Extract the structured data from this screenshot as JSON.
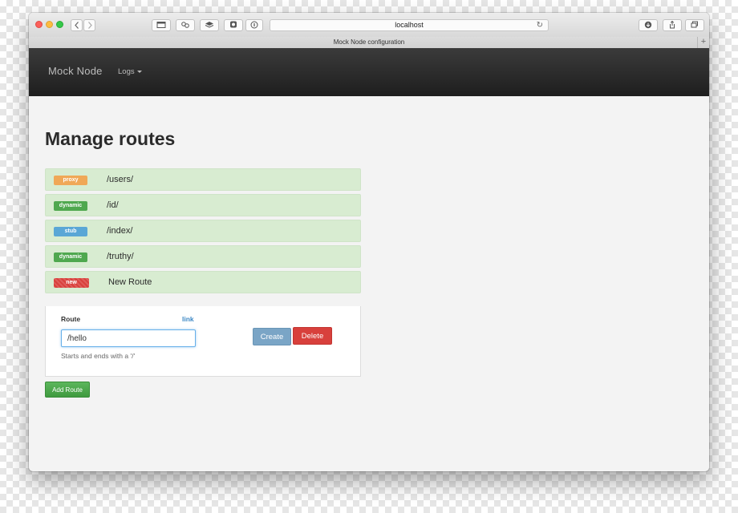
{
  "browser": {
    "url": "localhost",
    "tab_title": "Mock Node configuration",
    "new_tab_symbol": "+",
    "reload_symbol": "↻"
  },
  "navbar": {
    "brand": "Mock Node",
    "logs_label": "Logs"
  },
  "page": {
    "title": "Manage routes"
  },
  "routes": [
    {
      "type": "proxy",
      "path": "/users/",
      "badge_color": "#f0a857"
    },
    {
      "type": "dynamic",
      "path": "/id/",
      "badge_color": "#4fa84f"
    },
    {
      "type": "stub",
      "path": "/index/",
      "badge_color": "#5aa7d6"
    },
    {
      "type": "dynamic",
      "path": "/truthy/",
      "badge_color": "#4fa84f"
    },
    {
      "type": "new",
      "path": "New Route",
      "badge_color": "#d9403c"
    }
  ],
  "editor": {
    "route_label": "Route",
    "link_label": "link",
    "route_value": "/hello",
    "help_text": "Starts and ends with a '/'",
    "create_label": "Create",
    "delete_label": "Delete"
  },
  "actions": {
    "add_route_label": "Add Route"
  },
  "colors": {
    "accent_link": "#3d88c5",
    "row_background": "#d8ecd1",
    "navbar": "#2b2b2b"
  }
}
